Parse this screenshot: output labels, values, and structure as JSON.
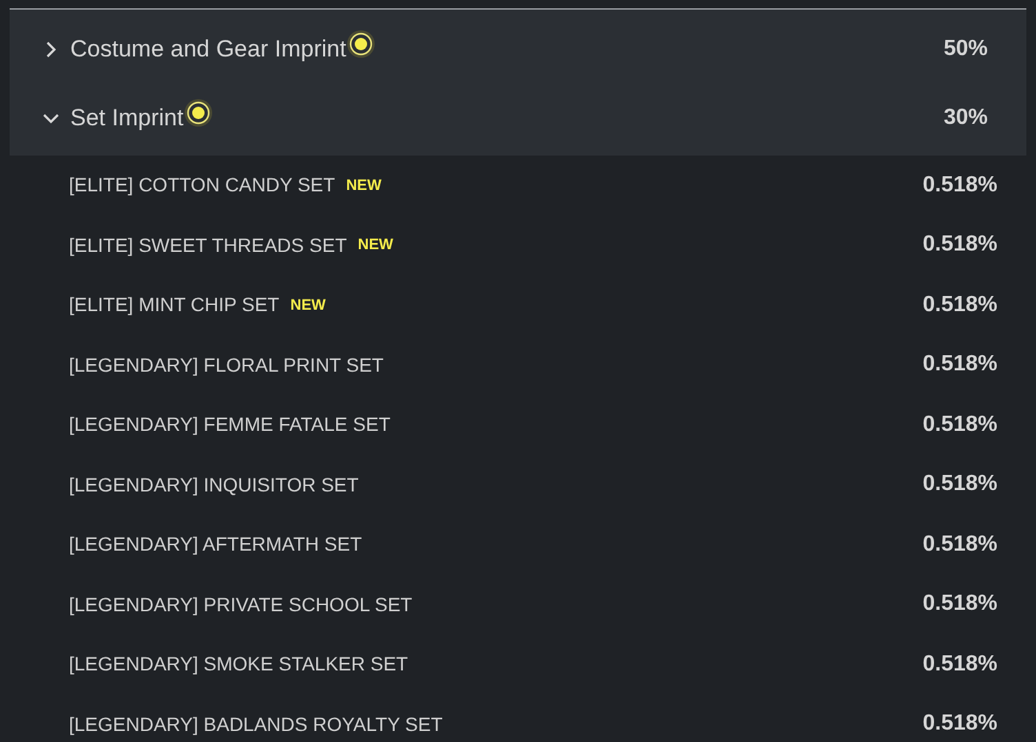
{
  "groups": [
    {
      "title": "Costume and Gear Imprint",
      "expanded": false,
      "percent": "50%"
    },
    {
      "title": "Set Imprint",
      "expanded": true,
      "percent": "30%",
      "items": [
        {
          "name": "[ELITE] COTTON CANDY SET",
          "badge": "NEW",
          "percent": "0.518%"
        },
        {
          "name": "[ELITE] SWEET THREADS SET",
          "badge": "NEW",
          "percent": "0.518%"
        },
        {
          "name": "[ELITE] MINT CHIP SET",
          "badge": "NEW",
          "percent": "0.518%"
        },
        {
          "name": "[LEGENDARY] FLORAL PRINT SET",
          "percent": "0.518%"
        },
        {
          "name": "[LEGENDARY] FEMME FATALE SET",
          "percent": "0.518%"
        },
        {
          "name": "[LEGENDARY] INQUISITOR SET",
          "percent": "0.518%"
        },
        {
          "name": "[LEGENDARY] AFTERMATH SET",
          "percent": "0.518%"
        },
        {
          "name": "[LEGENDARY] PRIVATE SCHOOL SET",
          "percent": "0.518%"
        },
        {
          "name": "[LEGENDARY] SMOKE STALKER SET",
          "percent": "0.518%"
        },
        {
          "name": "[LEGENDARY] BADLANDS ROYALTY SET",
          "percent": "0.518%"
        }
      ]
    }
  ]
}
